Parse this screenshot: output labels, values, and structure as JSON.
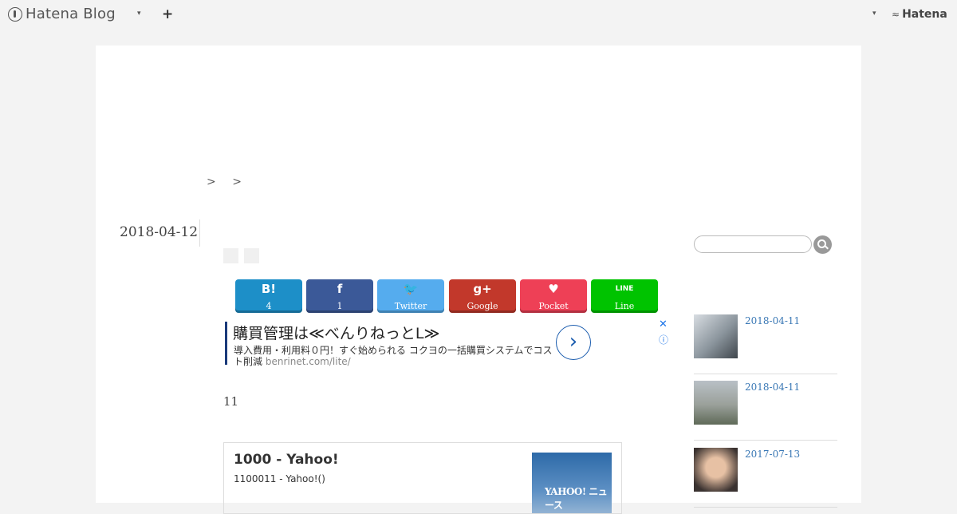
{
  "topbar": {
    "logo_text": "Hatena Blog",
    "menu_caret": "▾",
    "add_symbol": "+",
    "user_caret": "▾",
    "brand_text": "Hatena"
  },
  "breadcrumb": {
    "sep1": ">",
    "sep2": ">"
  },
  "post": {
    "date": "2018-04-12",
    "body_text": "11"
  },
  "share": {
    "buttons": [
      {
        "icon": "B!",
        "label": "4",
        "color": "#1d8fc8"
      },
      {
        "icon": "f",
        "label": "1",
        "color": "#3b5998"
      },
      {
        "icon": "🐦",
        "label": "Twitter",
        "color": "#55acee"
      },
      {
        "icon": "g+",
        "label": "Google",
        "color": "#c2382b"
      },
      {
        "icon": "♥",
        "label": "Pocket",
        "color": "#ee4056"
      },
      {
        "icon": "LINE",
        "label": "Line",
        "color": "#00c300"
      }
    ]
  },
  "ad": {
    "title": "購買管理は≪べんりねっとL≫",
    "description": "導入費用・利用料０円！すぐ始められる コクヨの一括購買システムでコスト削減",
    "url": "benrinet.com/lite/",
    "arrow": "›",
    "close": "✕",
    "info": "ⓘ"
  },
  "link_card": {
    "title": "1000 - Yahoo!",
    "description": "1100011 - Yahoo!()",
    "thumb_text": "YAHOO! ニュース"
  },
  "sidebar": {
    "search_placeholder": "",
    "related": [
      {
        "date": "2018-04-11"
      },
      {
        "date": "2018-04-11"
      },
      {
        "date": "2017-07-13"
      }
    ]
  }
}
